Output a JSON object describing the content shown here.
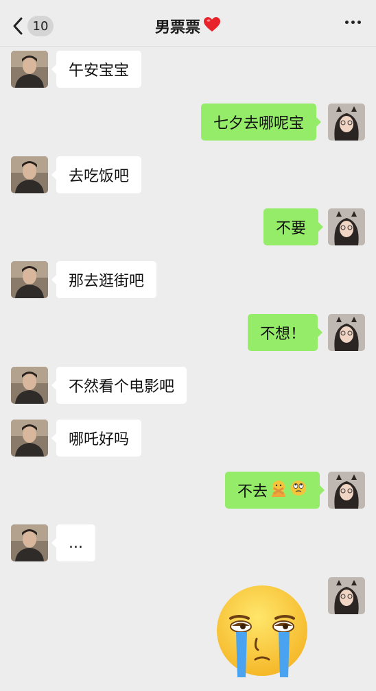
{
  "header": {
    "back_count": "10",
    "title": "男票票",
    "title_emoji": "heart-icon"
  },
  "messages": [
    {
      "side": "in",
      "text": "午安宝宝"
    },
    {
      "side": "out",
      "text": "七夕去哪呢宝"
    },
    {
      "side": "in",
      "text": "去吃饭吧"
    },
    {
      "side": "out",
      "text": "不要"
    },
    {
      "side": "in",
      "text": "那去逛街吧"
    },
    {
      "side": "out",
      "text": "不想！"
    },
    {
      "side": "in",
      "text": "不然看个电影吧"
    },
    {
      "side": "in",
      "text": "哪吒好吗"
    },
    {
      "side": "out",
      "text": "不去",
      "emojis": [
        "no-gesture-emoji",
        "eye-roll-emoji"
      ]
    },
    {
      "side": "in",
      "text": "..."
    },
    {
      "side": "out",
      "sticker": "crying-face-sticker"
    }
  ],
  "colors": {
    "background": "#ededed",
    "outgoing_bubble": "#95ec69",
    "incoming_bubble": "#ffffff"
  }
}
